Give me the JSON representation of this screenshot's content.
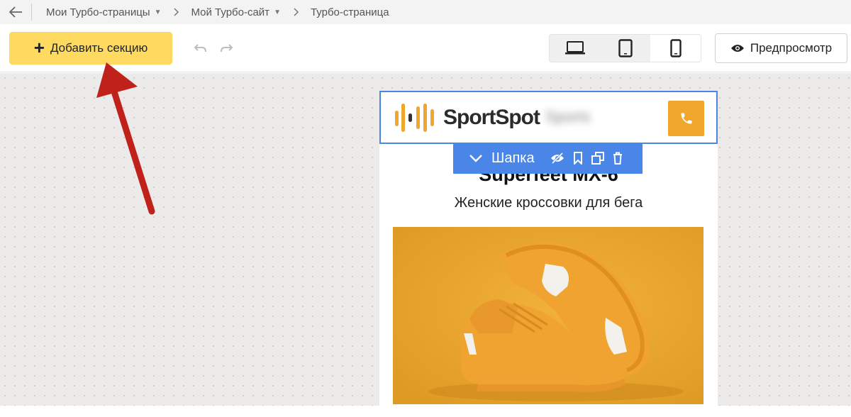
{
  "breadcrumb": {
    "items": [
      {
        "label": "Мои Турбо-страницы",
        "has_caret": true
      },
      {
        "label": "Мой Турбо-сайт",
        "has_caret": true
      },
      {
        "label": "Турбо-страница",
        "has_caret": false
      }
    ]
  },
  "toolbar": {
    "add_section_label": "Добавить секцию",
    "preview_label": "Предпросмотр",
    "active_device": "mobile"
  },
  "editor": {
    "header_section": {
      "brand": "SportSpot",
      "brand_suffix_blurred": "Sports",
      "section_name": "Шапка"
    },
    "product": {
      "title": "Superfeet MX-6",
      "subtitle": "Женские кроссовки для бега"
    }
  },
  "colors": {
    "accent_yellow": "#fedb60",
    "selection_blue": "#4a86e8",
    "phone_orange": "#f0a72e",
    "arrow_red": "#c0211a"
  }
}
